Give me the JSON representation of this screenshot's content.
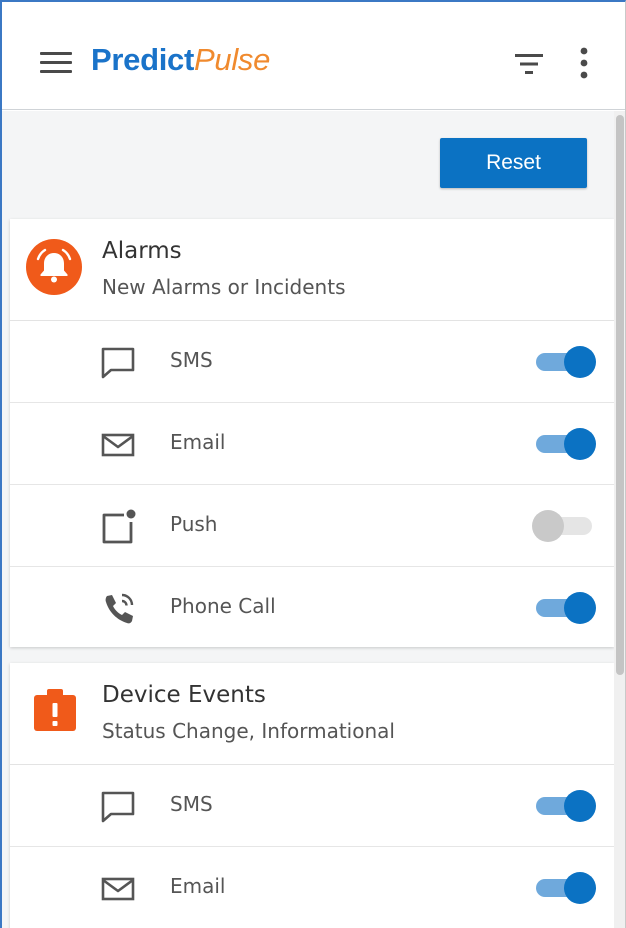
{
  "header": {
    "logo_part1": "Predict",
    "logo_part2": "Pulse",
    "menu_icon": "hamburger-icon",
    "filter_icon": "filter-icon",
    "more_icon": "more-vertical-icon"
  },
  "toolbar": {
    "reset_label": "Reset"
  },
  "colors": {
    "brand_blue": "#0b72c3",
    "brand_orange": "#f08a2e",
    "alarm_orange": "#f05a1a",
    "toggle_on_track": "#6fa9dc",
    "toggle_off": "#c9c9c9"
  },
  "sections": [
    {
      "title": "Alarms",
      "subtitle": "New Alarms or Incidents",
      "icon": "alarm-bell-icon",
      "channels": [
        {
          "label": "SMS",
          "icon": "sms-icon",
          "enabled": true
        },
        {
          "label": "Email",
          "icon": "email-icon",
          "enabled": true
        },
        {
          "label": "Push",
          "icon": "push-notification-icon",
          "enabled": false
        },
        {
          "label": "Phone Call",
          "icon": "phone-call-icon",
          "enabled": true
        }
      ]
    },
    {
      "title": "Device Events",
      "subtitle": "Status Change, Informational",
      "icon": "device-event-icon",
      "channels": [
        {
          "label": "SMS",
          "icon": "sms-icon",
          "enabled": true
        },
        {
          "label": "Email",
          "icon": "email-icon",
          "enabled": true
        }
      ]
    }
  ]
}
